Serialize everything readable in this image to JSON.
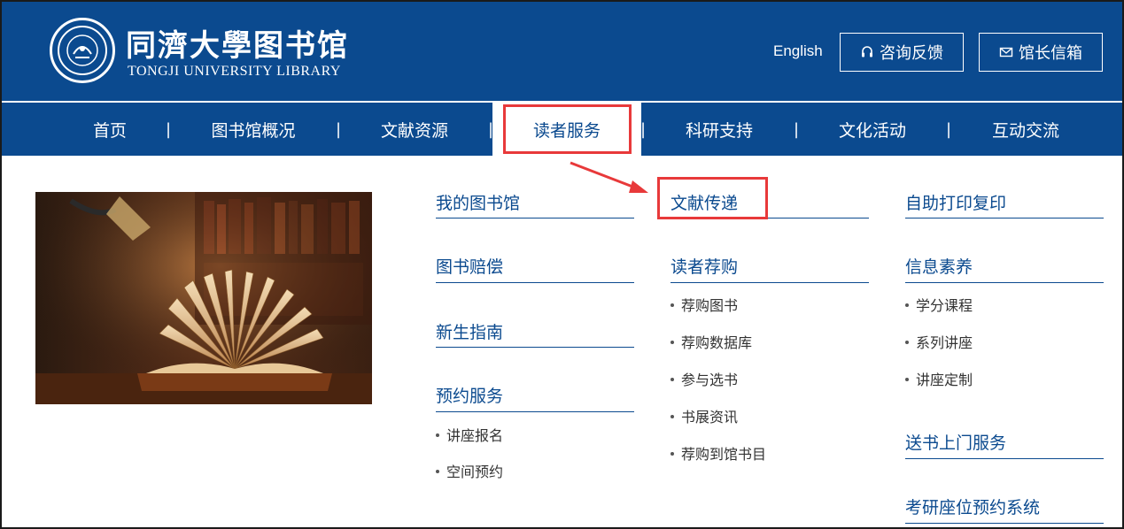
{
  "header": {
    "logo_cn": "同濟大學图书馆",
    "logo_en": "TONGJI UNIVERSITY LIBRARY",
    "lang_link": "English",
    "consult_button": "咨询反馈",
    "mail_button": "馆长信箱",
    "icons": {
      "consult": "headset-icon",
      "mail": "mail-icon",
      "seal": "university-seal-icon"
    }
  },
  "nav": {
    "items": [
      "首页",
      "图书馆概况",
      "文献资源",
      "读者服务",
      "科研支持",
      "文化活动",
      "互动交流"
    ],
    "active": "读者服务",
    "separator": "|"
  },
  "menu": {
    "col1": {
      "heads": [
        "我的图书馆",
        "图书赔偿",
        "新生指南",
        "预约服务"
      ],
      "subs": [
        "讲座报名",
        "空间预约"
      ]
    },
    "col2": {
      "heads": [
        "文献传递",
        "读者荐购"
      ],
      "subs": [
        "荐购图书",
        "荐购数据库",
        "参与选书",
        "书展资讯",
        "荐购到馆书目"
      ]
    },
    "col3": {
      "heads": [
        "自助打印复印",
        "信息素养",
        "送书上门服务",
        "考研座位预约系统"
      ],
      "subs": [
        "学分课程",
        "系列讲座",
        "讲座定制"
      ]
    }
  },
  "colors": {
    "brand_blue": "#0b4a8f",
    "highlight_red": "#e8393a",
    "text_gray": "#333333"
  }
}
